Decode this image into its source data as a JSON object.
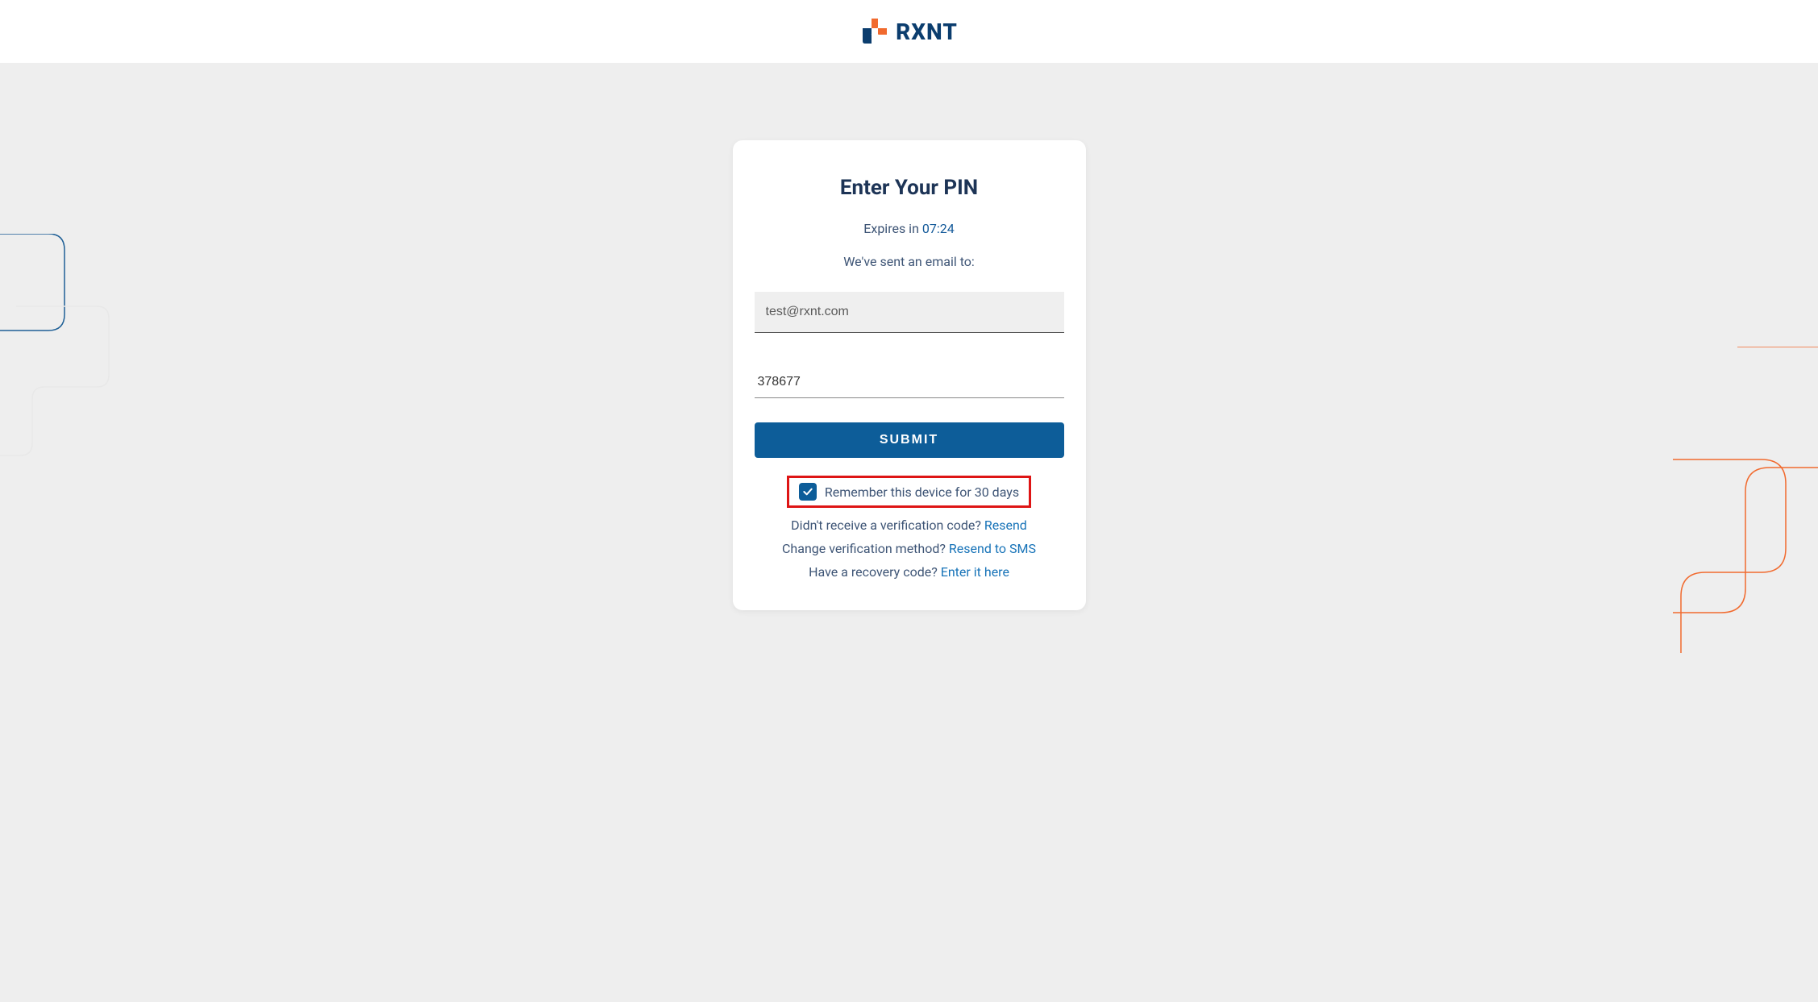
{
  "header": {
    "logo_text": "RXNT"
  },
  "card": {
    "title": "Enter Your PIN",
    "expires_prefix": "Expires in ",
    "expires_time": "07:24",
    "sent_text": "We've sent an email to:",
    "email_value": "test@rxnt.com",
    "pin_value": "378677",
    "submit_label": "SUBMIT",
    "remember_label": "Remember this device for 30 days",
    "remember_checked": true,
    "resend_prefix": "Didn't receive a verification code? ",
    "resend_link": "Resend",
    "change_prefix": "Change verification method? ",
    "change_link": "Resend to SMS",
    "recovery_prefix": "Have a recovery code? ",
    "recovery_link": "Enter it here"
  },
  "colors": {
    "brand_blue": "#0d5d99",
    "brand_orange": "#f16a2e",
    "text_dark": "#1d3456",
    "highlight_red": "#de1515"
  }
}
